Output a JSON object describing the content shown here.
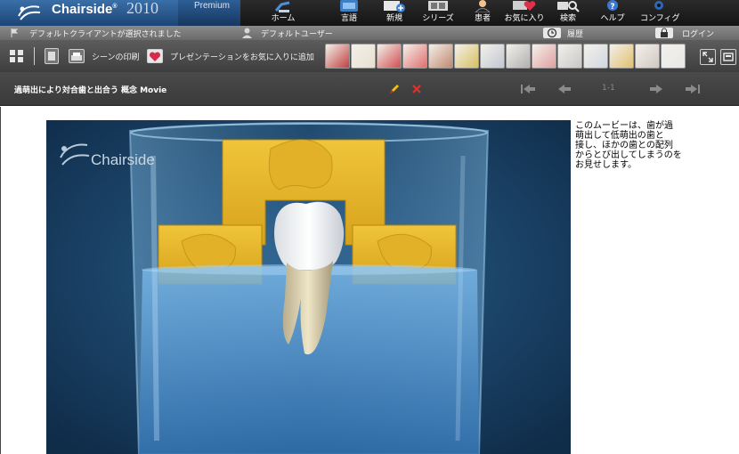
{
  "app": {
    "brand": "Chairside",
    "brand_mark": "®",
    "year": "2010",
    "edition": "Premium"
  },
  "nav": {
    "items": [
      {
        "label": "ホーム",
        "icon": "dental-chair-icon"
      },
      {
        "label": "言語",
        "icon": "language-globe-icon"
      },
      {
        "label": "新規",
        "icon": "new-plus-icon"
      },
      {
        "label": "シリーズ",
        "icon": "film-series-icon"
      },
      {
        "label": "患者",
        "icon": "patient-icon"
      },
      {
        "label": "お気に入り",
        "icon": "favorite-heart-icon"
      },
      {
        "label": "検索",
        "icon": "search-icon"
      },
      {
        "label": "ヘルプ",
        "icon": "help-icon"
      },
      {
        "label": "コンフィグ",
        "icon": "gear-icon"
      }
    ]
  },
  "status": {
    "client": "デフォルトクライアントが選択されました",
    "user": "デフォルトユーザー",
    "history": "履歴",
    "login": "ログイン"
  },
  "toolbar": {
    "print_scene": "シーンの印刷",
    "add_favorite": "プレゼンテーションをお気に入りに追加",
    "thumb_count": 14
  },
  "titlebar": {
    "title": "過萌出により対合歯と出合う  概念  Movie",
    "page": "1-1"
  },
  "movie": {
    "watermark": "Chairside"
  },
  "description": "このムービーは、歯が過\n萌出して低萌出の歯と\n接し、ほかの歯との配列\nからとび出してしまうのを\nお見せします。",
  "colors": {
    "accent_blue": "#1d4576",
    "water": "#4b8fc8",
    "sponge": "#e6b52a",
    "pencil": "#f2c400",
    "delete": "#e0302a"
  }
}
